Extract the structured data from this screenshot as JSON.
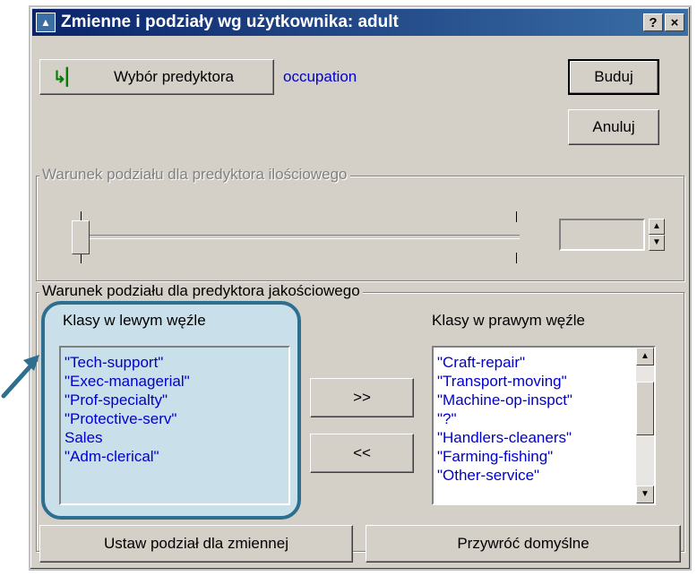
{
  "window": {
    "title": "Zmienne i podziały wg użytkownika: adult",
    "help_label": "?",
    "close_label": "×"
  },
  "toolbar": {
    "predictor_button_label": "Wybór predyktora",
    "predictor_value": "occupation",
    "build_label": "Buduj",
    "cancel_label": "Anuluj"
  },
  "quantitative": {
    "group_label": "Warunek podziału dla predyktora ilościowego",
    "value": ""
  },
  "qualitative": {
    "group_label": "Warunek podziału dla predyktora jakościowego",
    "left_label": "Klasy w lewym węźle",
    "right_label": "Klasy w prawym węźle",
    "left_items": [
      "\"Tech-support\"",
      "\"Exec-managerial\"",
      "\"Prof-specialty\"",
      "\"Protective-serv\"",
      "Sales",
      "\"Adm-clerical\""
    ],
    "right_items": [
      "\"Craft-repair\"",
      "\"Transport-moving\"",
      "\"Machine-op-inspct\"",
      "\"?\"",
      "\"Handlers-cleaners\"",
      "\"Farming-fishing\"",
      "\"Other-service\""
    ],
    "move_right_label": ">>",
    "move_left_label": "<<"
  },
  "footer": {
    "set_split_label": "Ustaw podział dla zmiennej",
    "restore_label": "Przywróć domyślne"
  },
  "colors": {
    "highlight_fill": "#c9dfea",
    "highlight_border": "#2e6e8e",
    "title_bar": "#0a246a",
    "list_text": "#0000cc"
  }
}
